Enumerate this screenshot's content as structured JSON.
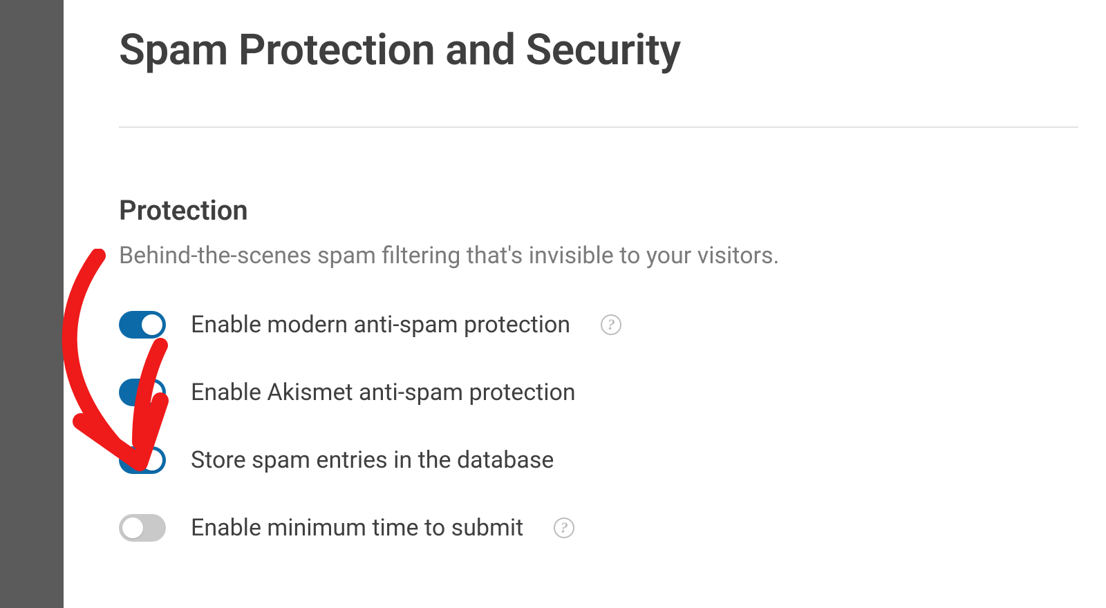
{
  "pageTitle": "Spam Protection and Security",
  "section": {
    "title": "Protection",
    "description": "Behind-the-scenes spam filtering that's invisible to your visitors."
  },
  "options": [
    {
      "label": "Enable modern anti-spam protection",
      "enabled": true,
      "hasHelp": true
    },
    {
      "label": "Enable Akismet anti-spam protection",
      "enabled": true,
      "hasHelp": false
    },
    {
      "label": "Store spam entries in the database",
      "enabled": true,
      "hasHelp": false
    },
    {
      "label": "Enable minimum time to submit",
      "enabled": false,
      "hasHelp": true
    }
  ],
  "helpGlyph": "?"
}
